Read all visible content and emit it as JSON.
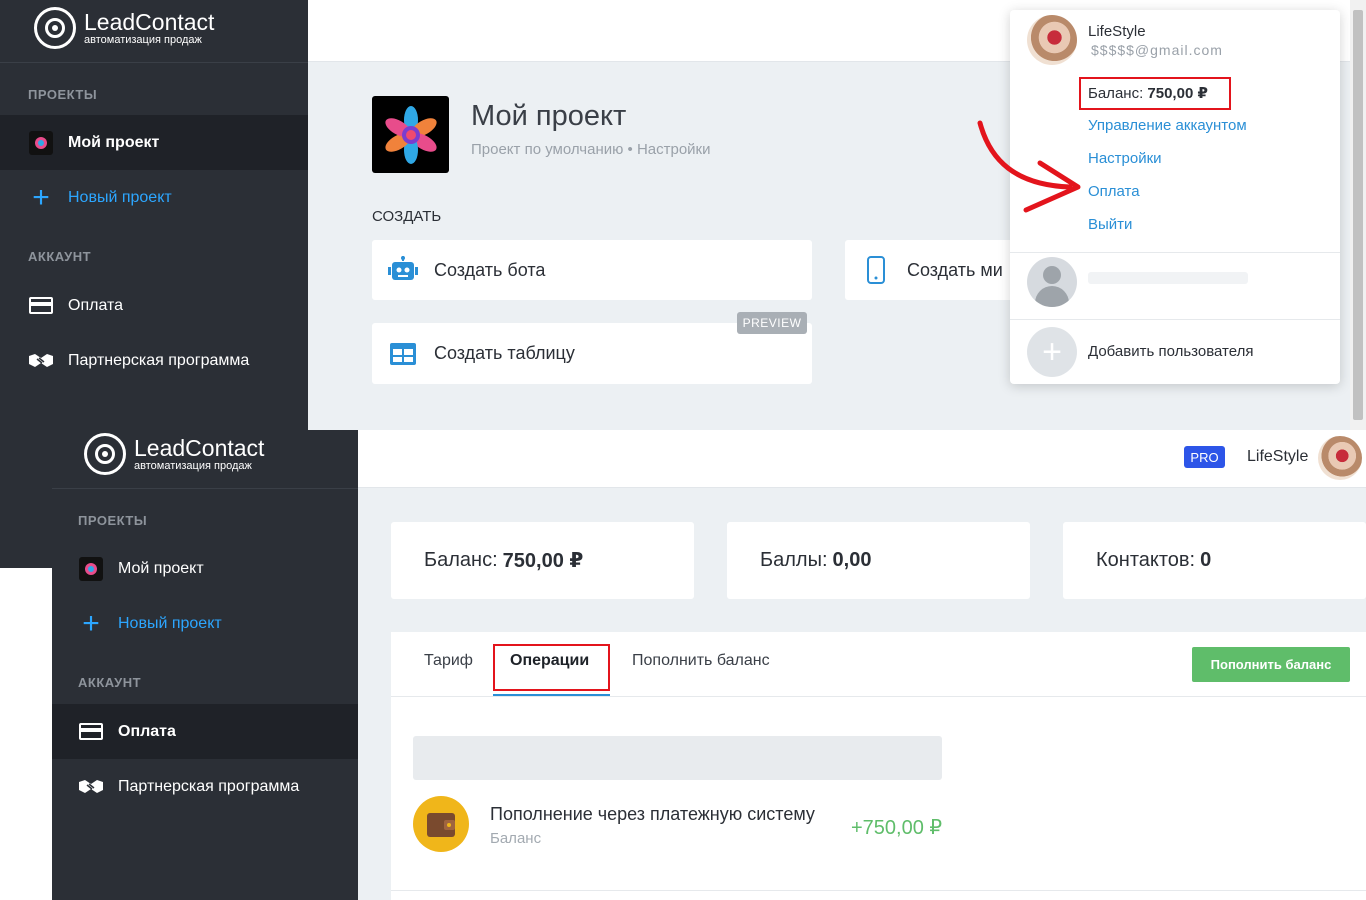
{
  "brand": {
    "name": "LeadContact",
    "tagline": "автоматизация продаж"
  },
  "sidebar": {
    "section_projects": "ПРОЕКТЫ",
    "my_project": "Мой проект",
    "new_project": "Новый проект",
    "section_account": "АККАУНТ",
    "payment": "Оплата",
    "partner": "Партнерская программа"
  },
  "project": {
    "title": "Мой проект",
    "subtitle": "Проект по умолчанию • Настройки",
    "create_heading": "СОЗДАТЬ",
    "create_bot": "Создать бота",
    "create_mini": "Создать ми",
    "create_table": "Создать таблицу",
    "preview_badge": "PREVIEW"
  },
  "dropdown": {
    "user_name": "LifeStyle",
    "user_email": "$$$$$@gmail.com",
    "balance_label": "Баланс:",
    "balance_value": "750,00 ₽",
    "manage_account": "Управление аккаунтом",
    "settings": "Настройки",
    "payment": "Оплата",
    "logout": "Выйти",
    "add_user": "Добавить пользователя"
  },
  "header2": {
    "pro_badge": "PRO",
    "user_name": "LifeStyle"
  },
  "stats": {
    "balance_label": "Баланс:",
    "balance_value": "750,00 ₽",
    "points_label": "Баллы:",
    "points_value": "0,00",
    "contacts_label": "Контактов:",
    "contacts_value": "0"
  },
  "tabs": {
    "tariff": "Тариф",
    "operations": "Операции",
    "topup": "Пополнить баланс",
    "topup_button": "Пополнить баланс"
  },
  "operation": {
    "title": "Пополнение через платежную систему",
    "subtitle": "Баланс",
    "amount": "+750,00 ₽"
  },
  "colors": {
    "sidebar": "#2b2f36",
    "link": "#2a8fd6",
    "accent_blue": "#2ca6ff",
    "green": "#5fbd6a",
    "highlight_red": "#e3141c",
    "pro_badge": "#2d55e8"
  },
  "icons": [
    "logo-icon",
    "project-flower-icon",
    "plus-icon",
    "credit-card-icon",
    "handshake-icon",
    "robot-icon",
    "mobile-icon",
    "table-icon",
    "avatar",
    "wallet-icon",
    "red-arrow"
  ]
}
